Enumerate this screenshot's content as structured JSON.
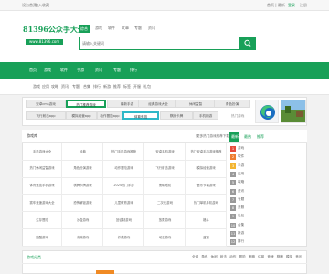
{
  "topbar": {
    "left_links": [
      "设为首页",
      "加入收藏"
    ],
    "right_text": "首页 | 最新",
    "login": "登录",
    "register": "注册"
  },
  "logo": {
    "title": "81396公众手大全",
    "url": "www.81396.com"
  },
  "search": {
    "tabs": [
      "综合",
      "游戏",
      "软件",
      "文章",
      "专题",
      "资讯"
    ],
    "active_tab": 0,
    "placeholder": "请输入关键词"
  },
  "nav": {
    "items": [
      "首页",
      "游戏",
      "软件",
      "手游",
      "资讯",
      "专题",
      "排行"
    ]
  },
  "subnav": {
    "items": [
      "游戏",
      "应用",
      "攻略",
      "资讯",
      "专题",
      "合集",
      "排行",
      "新游",
      "推荐",
      "标签",
      "开服",
      "礼包"
    ]
  },
  "keywords": {
    "row1": [
      "安卓cms游戏",
      "热门推荐游戏",
      "最新手游",
      "经典游戏大全",
      "休闲益智",
      "角色扮演"
    ],
    "row2": [
      "飞行射击app",
      "模拟经营app",
      "动作冒险app",
      "体育竞技",
      "棋牌卡牌",
      "手机网游"
    ]
  },
  "thumb_caption": "热门游戏",
  "list_section": {
    "title": "游戏库",
    "header_link": "更多热门游戏推荐下载大全",
    "tabs": [
      "最新",
      "最热",
      "推荐"
    ],
    "active_tab": 0,
    "rows": [
      [
        "手机游戏大全",
        "经典",
        "热门手机游戏推荐",
        "安卓手机游戏",
        "热门安卓手机游戏推荐"
      ],
      [
        "热门休闲益智游戏",
        "角色扮演游戏",
        "动作冒险游戏",
        "飞行射击游戏",
        "模拟经营游戏"
      ],
      [
        "体育竞技手机游戏",
        "棋牌卡牌游戏",
        "2024热门手游",
        "策略塔防",
        "音乐节奏游戏"
      ],
      [
        "赛车竞速游戏大全",
        "恐怖解谜游戏",
        "儿童教育游戏",
        "二次元游戏",
        "热门单机手机游戏"
      ],
      [
        "生存冒险",
        "沙盒游戏",
        "回合制游戏",
        "放置游戏",
        "格斗"
      ],
      [
        "跑酷游戏",
        "消除游戏",
        "养成游戏",
        "动漫游戏",
        "益智"
      ]
    ],
    "rank_labels": [
      "游戏",
      "软件",
      "手游",
      "应用",
      "攻略",
      "资讯",
      "专题",
      "开服",
      "礼包",
      "合集",
      "新游",
      "排行"
    ]
  },
  "bottom_section": {
    "title": "游戏分类",
    "tabs": [
      "全部",
      "角色",
      "休闲",
      "射击",
      "动作",
      "冒险",
      "策略",
      "体育",
      "竞速",
      "棋牌",
      "模拟",
      "音乐"
    ]
  },
  "colors": {
    "brand": "#18a058",
    "rank": [
      "#e64b3b",
      "#ef7d31",
      "#f3b531",
      "#9a9a9a"
    ]
  }
}
